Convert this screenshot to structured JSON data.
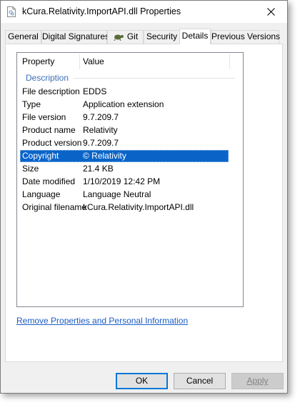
{
  "window": {
    "title": "kCura.Relativity.ImportAPI.dll Properties"
  },
  "tabs": [
    {
      "label": "General"
    },
    {
      "label": "Digital Signatures"
    },
    {
      "label": "Git",
      "icon": "git-tortoise-icon"
    },
    {
      "label": "Security"
    },
    {
      "label": "Details",
      "active": true
    },
    {
      "label": "Previous Versions"
    }
  ],
  "details": {
    "header_property": "Property",
    "header_value": "Value",
    "group_label": "Description",
    "rows": [
      {
        "property": "File description",
        "value": "EDDS"
      },
      {
        "property": "Type",
        "value": "Application extension"
      },
      {
        "property": "File version",
        "value": "9.7.209.7"
      },
      {
        "property": "Product name",
        "value": "Relativity"
      },
      {
        "property": "Product version",
        "value": "9.7.209.7"
      },
      {
        "property": "Copyright",
        "value": "© Relativity",
        "selected": true
      },
      {
        "property": "Size",
        "value": "21.4 KB"
      },
      {
        "property": "Date modified",
        "value": "1/10/2019 12:42 PM"
      },
      {
        "property": "Language",
        "value": "Language Neutral"
      },
      {
        "property": "Original filename",
        "value": "kCura.Relativity.ImportAPI.dll"
      }
    ]
  },
  "link_text": "Remove Properties and Personal Information",
  "buttons": {
    "ok": "OK",
    "cancel": "Cancel",
    "apply": "Apply"
  },
  "colors": {
    "selection": "#0a64c8",
    "link": "#1a5dc6",
    "group_header": "#3a6fb5",
    "default_button_border": "#0078d7"
  }
}
